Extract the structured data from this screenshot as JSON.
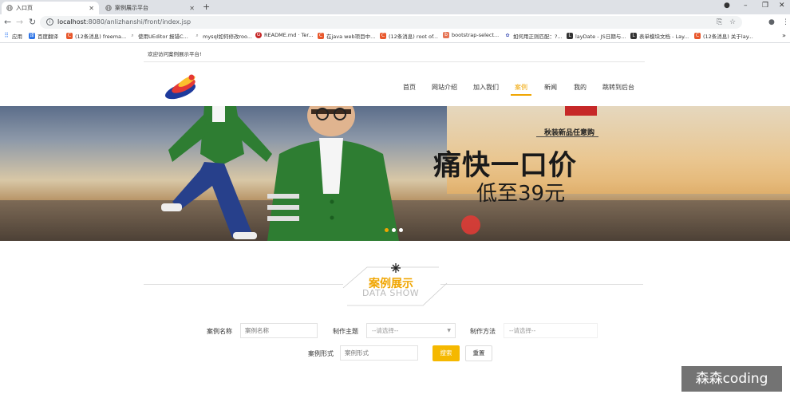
{
  "browser": {
    "tabs": [
      {
        "title": "入口页",
        "active": true
      },
      {
        "title": "案例展示平台",
        "active": false
      }
    ],
    "new_tab": "+",
    "url_host": "localhost",
    "url_path": ":8080/anlizhanshi/front/index.jsp",
    "bookmarks": [
      {
        "label": "应用",
        "icon_color": "#4285f4"
      },
      {
        "label": "百度翻译",
        "icon_color": "#2b73e6"
      },
      {
        "label": "(12条消息) freema...",
        "icon_color": "#e8572b"
      },
      {
        "label": "使用UEditor 报错C...",
        "icon_color": "#888888"
      },
      {
        "label": "mysql如何修改roo...",
        "icon_color": "#888888"
      },
      {
        "label": "README.md · Ter...",
        "icon_color": "#c62828"
      },
      {
        "label": "在java web项目中...",
        "icon_color": "#e8572b"
      },
      {
        "label": "(12条消息) root of...",
        "icon_color": "#e8572b"
      },
      {
        "label": "bootstrap-select...",
        "icon_color": "#e57353"
      },
      {
        "label": "如何用正则匹配：?...",
        "icon_color": "#3f51b5"
      },
      {
        "label": "layDate - JS日期与...",
        "icon_color": "#333333"
      },
      {
        "label": "表单模块文档 - Lay...",
        "icon_color": "#333333"
      },
      {
        "label": "(12条消息) 关于lay...",
        "icon_color": "#e8572b"
      }
    ],
    "bookmarks_more": "»"
  },
  "header": {
    "welcome": "欢迎访问案例展示平台!",
    "nav": [
      {
        "label": "首页",
        "active": false
      },
      {
        "label": "网站介绍",
        "active": false
      },
      {
        "label": "加入我们",
        "active": false
      },
      {
        "label": "案例",
        "active": true
      },
      {
        "label": "新闻",
        "active": false
      },
      {
        "label": "我的",
        "active": false
      },
      {
        "label": "跳转到后台",
        "active": false
      }
    ]
  },
  "banner": {
    "badge": "",
    "subtitle": "秋装新品任意购",
    "title": "痛快一口价",
    "price": "低至39元",
    "active_slide": 1,
    "slides": 3
  },
  "section": {
    "title": "案例展示",
    "subtitle": "DATA SHOW"
  },
  "search": {
    "name_label": "案例名称",
    "name_placeholder": "案例名称",
    "maker_label": "制作主题",
    "maker_value": "--请选择--",
    "method_label": "制作方法",
    "method_value": "--请选择--",
    "form_label": "案例形式",
    "form_placeholder": "案例形式",
    "search_button": "搜索",
    "reset_button": "重置"
  },
  "watermark": "森森coding",
  "colors": {
    "accent": "#f0a500",
    "search_button": "#f5b800"
  }
}
